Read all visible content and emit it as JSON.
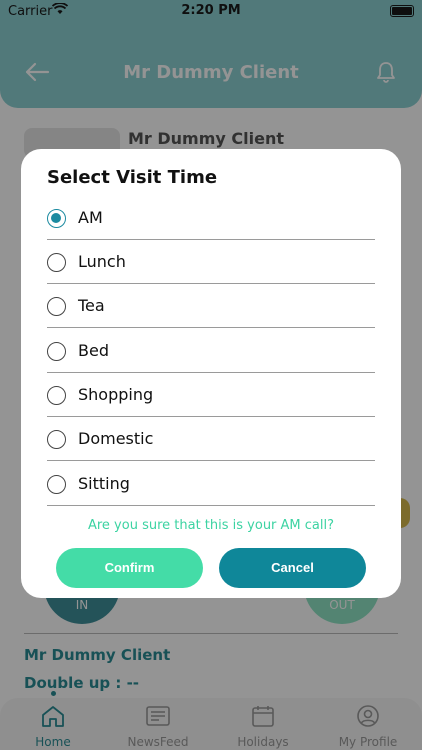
{
  "status_bar": {
    "carrier": "Carrier",
    "time": "2:20 PM"
  },
  "header": {
    "title": "Mr Dummy Client"
  },
  "background": {
    "client_name": "Mr Dummy Client",
    "in_label": "IN",
    "out_label": "OUT",
    "client_name_bottom": "Mr Dummy Client",
    "double_up": "Double up :  --"
  },
  "modal": {
    "title": "Select Visit Time",
    "options": [
      {
        "label": "AM",
        "selected": true
      },
      {
        "label": "Lunch",
        "selected": false
      },
      {
        "label": "Tea",
        "selected": false
      },
      {
        "label": "Bed",
        "selected": false
      },
      {
        "label": "Shopping",
        "selected": false
      },
      {
        "label": "Domestic",
        "selected": false
      },
      {
        "label": "Sitting",
        "selected": false
      }
    ],
    "question": "Are you sure that this is your AM call?",
    "confirm_label": "Confirm",
    "cancel_label": "Cancel"
  },
  "tabs": [
    {
      "label": "Home",
      "icon": "home-icon",
      "active": true
    },
    {
      "label": "NewsFeed",
      "icon": "newspaper-icon",
      "active": false
    },
    {
      "label": "Holidays",
      "icon": "calendar-icon",
      "active": false
    },
    {
      "label": "My Profile",
      "icon": "profile-icon",
      "active": false
    }
  ],
  "colors": {
    "accent": "#0f8799",
    "confirm": "#44dca7",
    "header": "#8cd0d2"
  }
}
